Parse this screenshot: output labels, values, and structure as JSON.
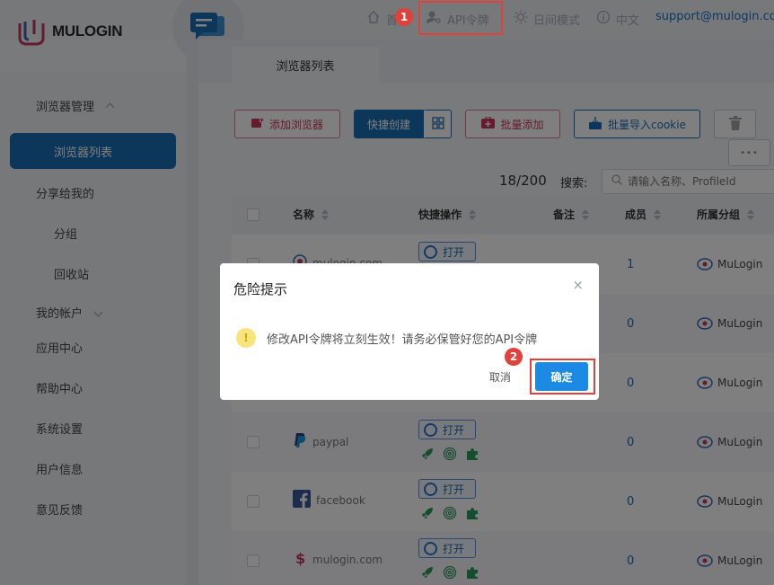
{
  "brand": {
    "name": "MULOGIN"
  },
  "top_nav": {
    "home_partial": "首",
    "api_token": "API令牌",
    "day_mode": "日间模式",
    "language": "中文",
    "support_email": "support@mulogin.com"
  },
  "annotations": {
    "step1": "1",
    "step2": "2"
  },
  "sidebar": {
    "browser_management": "浏览器管理",
    "browser_list": "浏览器列表",
    "shared_with_me": "分享给我的",
    "groups": "分组",
    "recycle_bin": "回收站",
    "my_account": "我的帐户",
    "app_center": "应用中心",
    "help_center": "帮助中心",
    "system_settings": "系统设置",
    "user_info": "用户信息",
    "feedback": "意见反馈"
  },
  "tabs": {
    "active": "浏览器列表"
  },
  "toolbar": {
    "add_browser": "添加浏览器",
    "quick_create": "快捷创建",
    "batch_add": "批量添加",
    "batch_import_cookie": "批量导入cookie",
    "more": "•••"
  },
  "list_meta": {
    "count": "18/200",
    "search_label": "搜索:",
    "search_placeholder": "请输入名称、ProfileId"
  },
  "table": {
    "headers": {
      "name": "名称",
      "quick_ops": "快捷操作",
      "note": "备注",
      "members": "成员",
      "group": "所属分组"
    },
    "open_label": "打开",
    "rows": [
      {
        "name": "mulogin.com",
        "members": "1",
        "group": "MuLogin"
      },
      {
        "name": "",
        "members": "0",
        "group": "MuLogin"
      },
      {
        "name": "",
        "members": "0",
        "group": "MuLogin"
      },
      {
        "name": "paypal",
        "members": "0",
        "group": "MuLogin"
      },
      {
        "name": "facebook",
        "members": "0",
        "group": "MuLogin"
      },
      {
        "name": "mulogin.com",
        "members": "0",
        "group": "MuLogin"
      }
    ]
  },
  "dialog": {
    "title": "危险提示",
    "message": "修改API令牌将立刻生效！请务必保管好您的API令牌",
    "cancel": "取消",
    "confirm": "确定",
    "close_glyph": "×",
    "warn_glyph": "!"
  },
  "colors": {
    "primary": "#1a6fb5",
    "confirm": "#1a8ae5",
    "highlight": "#e2403a",
    "pink": "#c9385c"
  }
}
